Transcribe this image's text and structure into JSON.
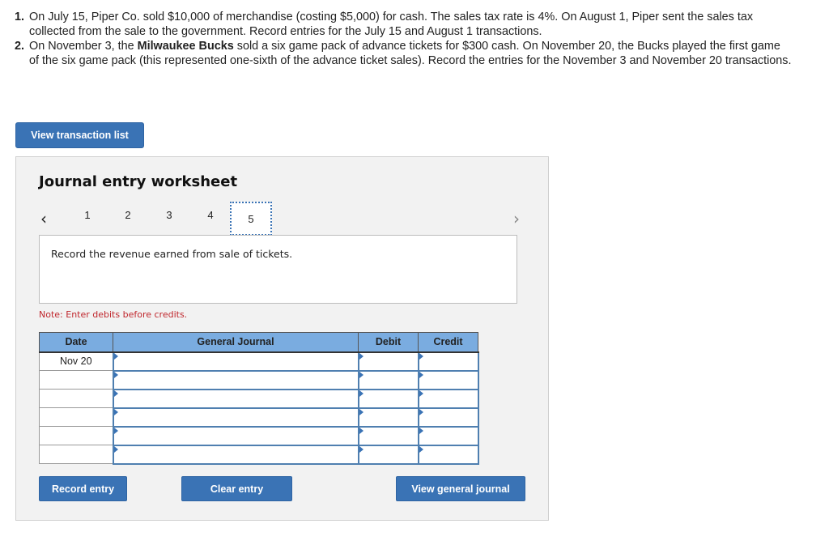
{
  "problems": [
    {
      "number": "1.",
      "segments": [
        {
          "text": "On July 15, Piper Co. sold $10,000 of merchandise (costing $5,000) for cash. The sales tax rate is 4%. On August 1, Piper sent the sales tax collected from the sale to the government. Record entries for the July 15 and August 1 transactions.",
          "bold": false
        }
      ]
    },
    {
      "number": "2.",
      "segments": [
        {
          "text": "On November 3, the ",
          "bold": false
        },
        {
          "text": "Milwaukee Bucks",
          "bold": true
        },
        {
          "text": " sold a six game pack of advance tickets for $300 cash. On November 20, the Bucks played the first game of the six game pack (this represented one-sixth of the advance ticket sales). Record the entries for the November 3 and November 20 transactions.",
          "bold": false
        }
      ]
    }
  ],
  "view_transactions_label": "View transaction list",
  "worksheet": {
    "title": "Journal entry worksheet",
    "pager": {
      "prev_icon": "‹",
      "next_icon": "›",
      "pages": [
        "1",
        "2",
        "3",
        "4",
        "5"
      ],
      "active_page": "5"
    },
    "instruction": "Record the revenue earned from sale of tickets.",
    "note": "Note: Enter debits before credits.",
    "table": {
      "headers": {
        "date": "Date",
        "account": "General Journal",
        "debit": "Debit",
        "credit": "Credit"
      },
      "rows": [
        {
          "date": "Nov 20",
          "account": "",
          "debit": "",
          "credit": ""
        },
        {
          "date": "",
          "account": "",
          "debit": "",
          "credit": ""
        },
        {
          "date": "",
          "account": "",
          "debit": "",
          "credit": ""
        },
        {
          "date": "",
          "account": "",
          "debit": "",
          "credit": ""
        },
        {
          "date": "",
          "account": "",
          "debit": "",
          "credit": ""
        },
        {
          "date": "",
          "account": "",
          "debit": "",
          "credit": ""
        }
      ]
    },
    "buttons": {
      "record": "Record entry",
      "clear": "Clear entry",
      "view_journal": "View general journal"
    }
  },
  "colors": {
    "button": "#3a73b5",
    "header": "#7aace0",
    "note": "#c0272d",
    "panel": "#f2f2f2"
  }
}
